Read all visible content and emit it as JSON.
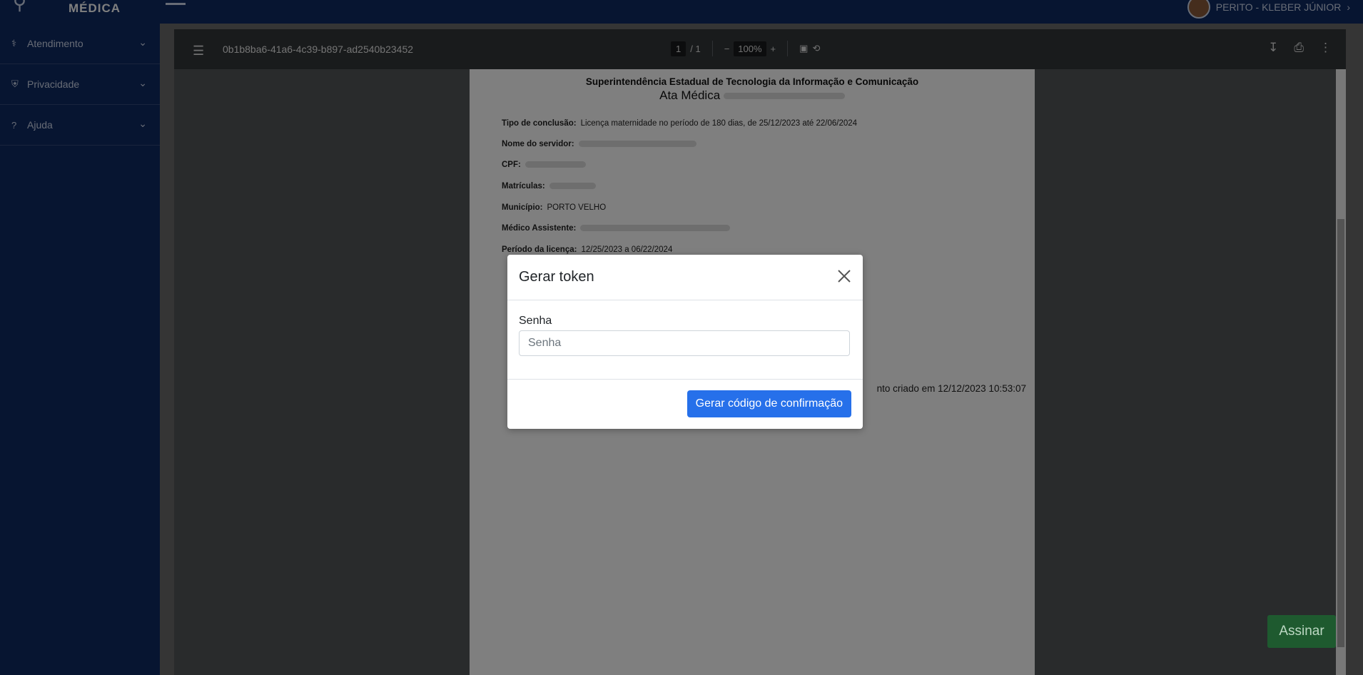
{
  "header": {
    "brand": "MÉDICA",
    "user": "PERITO - KLEBER JÚNIOR"
  },
  "sidebar": {
    "items": [
      {
        "label": "Atendimento",
        "icon": "stethoscope-icon"
      },
      {
        "label": "Privacidade",
        "icon": "shield-icon"
      },
      {
        "label": "Ajuda",
        "icon": "question-icon"
      }
    ]
  },
  "viewer": {
    "file_id": "0b1b8ba6-41a6-4c39-b897-ad2540b23452",
    "page_current": "1",
    "page_total": "/ 1",
    "zoom": "100%"
  },
  "document": {
    "org": "Superintendência Estadual de Tecnologia da Informação e Comunicação",
    "ata_label": "Ata Médica",
    "rows": [
      {
        "label": "Tipo de conclusão:",
        "value": "Licença maternidade no período de 180 dias, de 25/12/2023 até 22/06/2024"
      },
      {
        "label": "Nome do servidor:",
        "value": ""
      },
      {
        "label": "CPF:",
        "value": ""
      },
      {
        "label": "Matrículas:",
        "value": ""
      },
      {
        "label": "Município:",
        "value": "PORTO VELHO"
      },
      {
        "label": "Médico Assistente:",
        "value": ""
      },
      {
        "label": "Período da licença:",
        "value": "12/25/2023 a 06/22/2024"
      }
    ],
    "footer": "nto criado em 12/12/2023 10:53:07"
  },
  "modal": {
    "title": "Gerar token",
    "field_label": "Senha",
    "field_placeholder": "Senha",
    "submit": "Gerar código de confirmação"
  },
  "assinar": "Assinar"
}
